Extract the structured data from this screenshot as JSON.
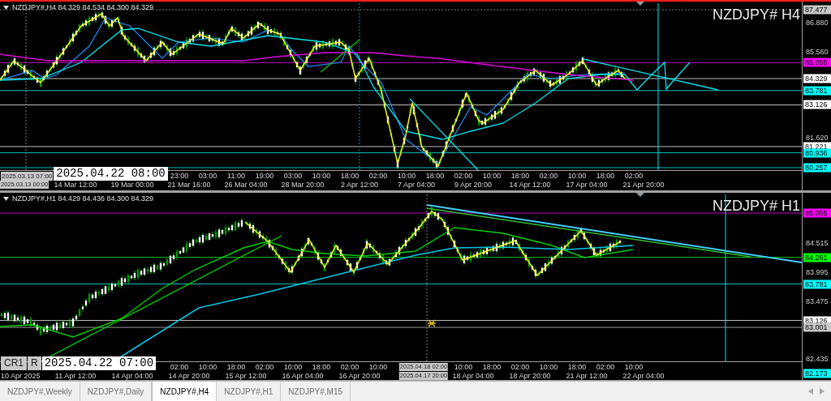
{
  "charts": [
    {
      "header": "NZDJPY#,H4 84.329 84.534 84.300 84.329",
      "title": "NZDJPY# H4",
      "active": true,
      "price_axis": [
        {
          "text": "87.477",
          "kind": "tag",
          "color": "#c8c8c8"
        },
        {
          "text": "86.880",
          "kind": "tick"
        },
        {
          "text": "85.560",
          "kind": "tick"
        },
        {
          "text": "85.055",
          "kind": "tag",
          "color": "#ff00ff"
        },
        {
          "text": "84.329",
          "kind": "tag",
          "color": "#ffffff"
        },
        {
          "text": "83.781",
          "kind": "tag",
          "color": "#00ffff"
        },
        {
          "text": "83.126",
          "kind": "tag",
          "color": "#ffffff"
        },
        {
          "text": "81.620",
          "kind": "tick"
        },
        {
          "text": "81.221",
          "kind": "tag",
          "color": "#ffffff"
        },
        {
          "text": "80.936",
          "kind": "tag",
          "color": "#00ffff"
        },
        {
          "text": "80.257",
          "kind": "tag",
          "color": "#00ffff"
        }
      ],
      "cursor_labels": [
        {
          "text": "2025.03.13 07:00",
          "kind": "grey"
        },
        {
          "text": "2025.04.22 08:00",
          "kind": "large"
        }
      ],
      "hours": [
        "23:00",
        "03:00",
        "11:00",
        "19:00",
        "03:00",
        "10:00",
        "18:00",
        "02:00",
        "10:00",
        "18:00",
        "02:00",
        "10:00",
        "18:00",
        "02:00",
        "10:00",
        "18:00",
        "02:00"
      ],
      "date_start": {
        "text": "2025.03.13 00:00",
        "kind": "grey"
      },
      "dates": [
        "14 Mar 12:00",
        "19 Mar 00:00",
        "21 Mar 16:00",
        "26 Mar 04:00",
        "28 Mar 20:00",
        "2 Apr 12:00",
        "7 Apr 04:00",
        "9 Apr 20:00",
        "14 Apr 12:00",
        "17 Apr 04:00",
        "21 Apr 20:00"
      ]
    },
    {
      "header": "NZDJPY#,H1 84.429 84.436 84.300 84.329",
      "title": "NZDJPY# H1",
      "active": false,
      "price_axis": [
        {
          "text": "85.055",
          "kind": "tag",
          "color": "#ff00ff"
        },
        {
          "text": "84.515",
          "kind": "tick"
        },
        {
          "text": "84.261",
          "kind": "tag",
          "color": "#00ff00"
        },
        {
          "text": "83.995",
          "kind": "tick"
        },
        {
          "text": "83.781",
          "kind": "tag",
          "color": "#00ffff"
        },
        {
          "text": "83.475",
          "kind": "tick"
        },
        {
          "text": "83.126",
          "kind": "tag",
          "color": "#ffffff"
        },
        {
          "text": "83.001",
          "kind": "tag",
          "color": "#c8c8c8"
        },
        {
          "text": "82.435",
          "kind": "tick"
        },
        {
          "text": "82.173",
          "kind": "tag",
          "color": "#00ffff"
        }
      ],
      "cursor_labels": [
        {
          "text": "CR1",
          "kind": "grey"
        },
        {
          "text": "R",
          "kind": "grey"
        },
        {
          "text": "2025.04.22 07:00",
          "kind": "large"
        }
      ],
      "hours": [
        "02:00",
        "10:00",
        "18:00",
        "02:00",
        "10:00",
        "18:00",
        "02:00",
        "10:00",
        "10:00",
        "18:00",
        "02:00",
        "10:00",
        "18:00",
        "02:00",
        "10:00"
      ],
      "hour_marker": "2025.04.18 02:00",
      "date_start": {
        "text": "10 Apr 2025",
        "kind": "plain"
      },
      "dates": [
        "11 Apr 12:00",
        "14 Apr 04:00",
        "14 Apr 20:00",
        "15 Apr 12:00",
        "16 Apr 04:00",
        "16 Apr 20:00",
        "18 Apr 04:00",
        "18 Apr 20:00",
        "21 Apr 12:00",
        "22 Apr 04:00"
      ],
      "date_marker": "2025.04.17 20:00"
    }
  ],
  "tabs": [
    {
      "label": "NZDJPY#,Weekly",
      "selected": false
    },
    {
      "label": "NZDJPY#,Daily",
      "selected": false
    },
    {
      "label": "NZDJPY#,H4",
      "selected": true
    },
    {
      "label": "NZDJPY#,H1",
      "selected": false
    },
    {
      "label": "NZDJPY#,M15",
      "selected": false
    }
  ]
}
